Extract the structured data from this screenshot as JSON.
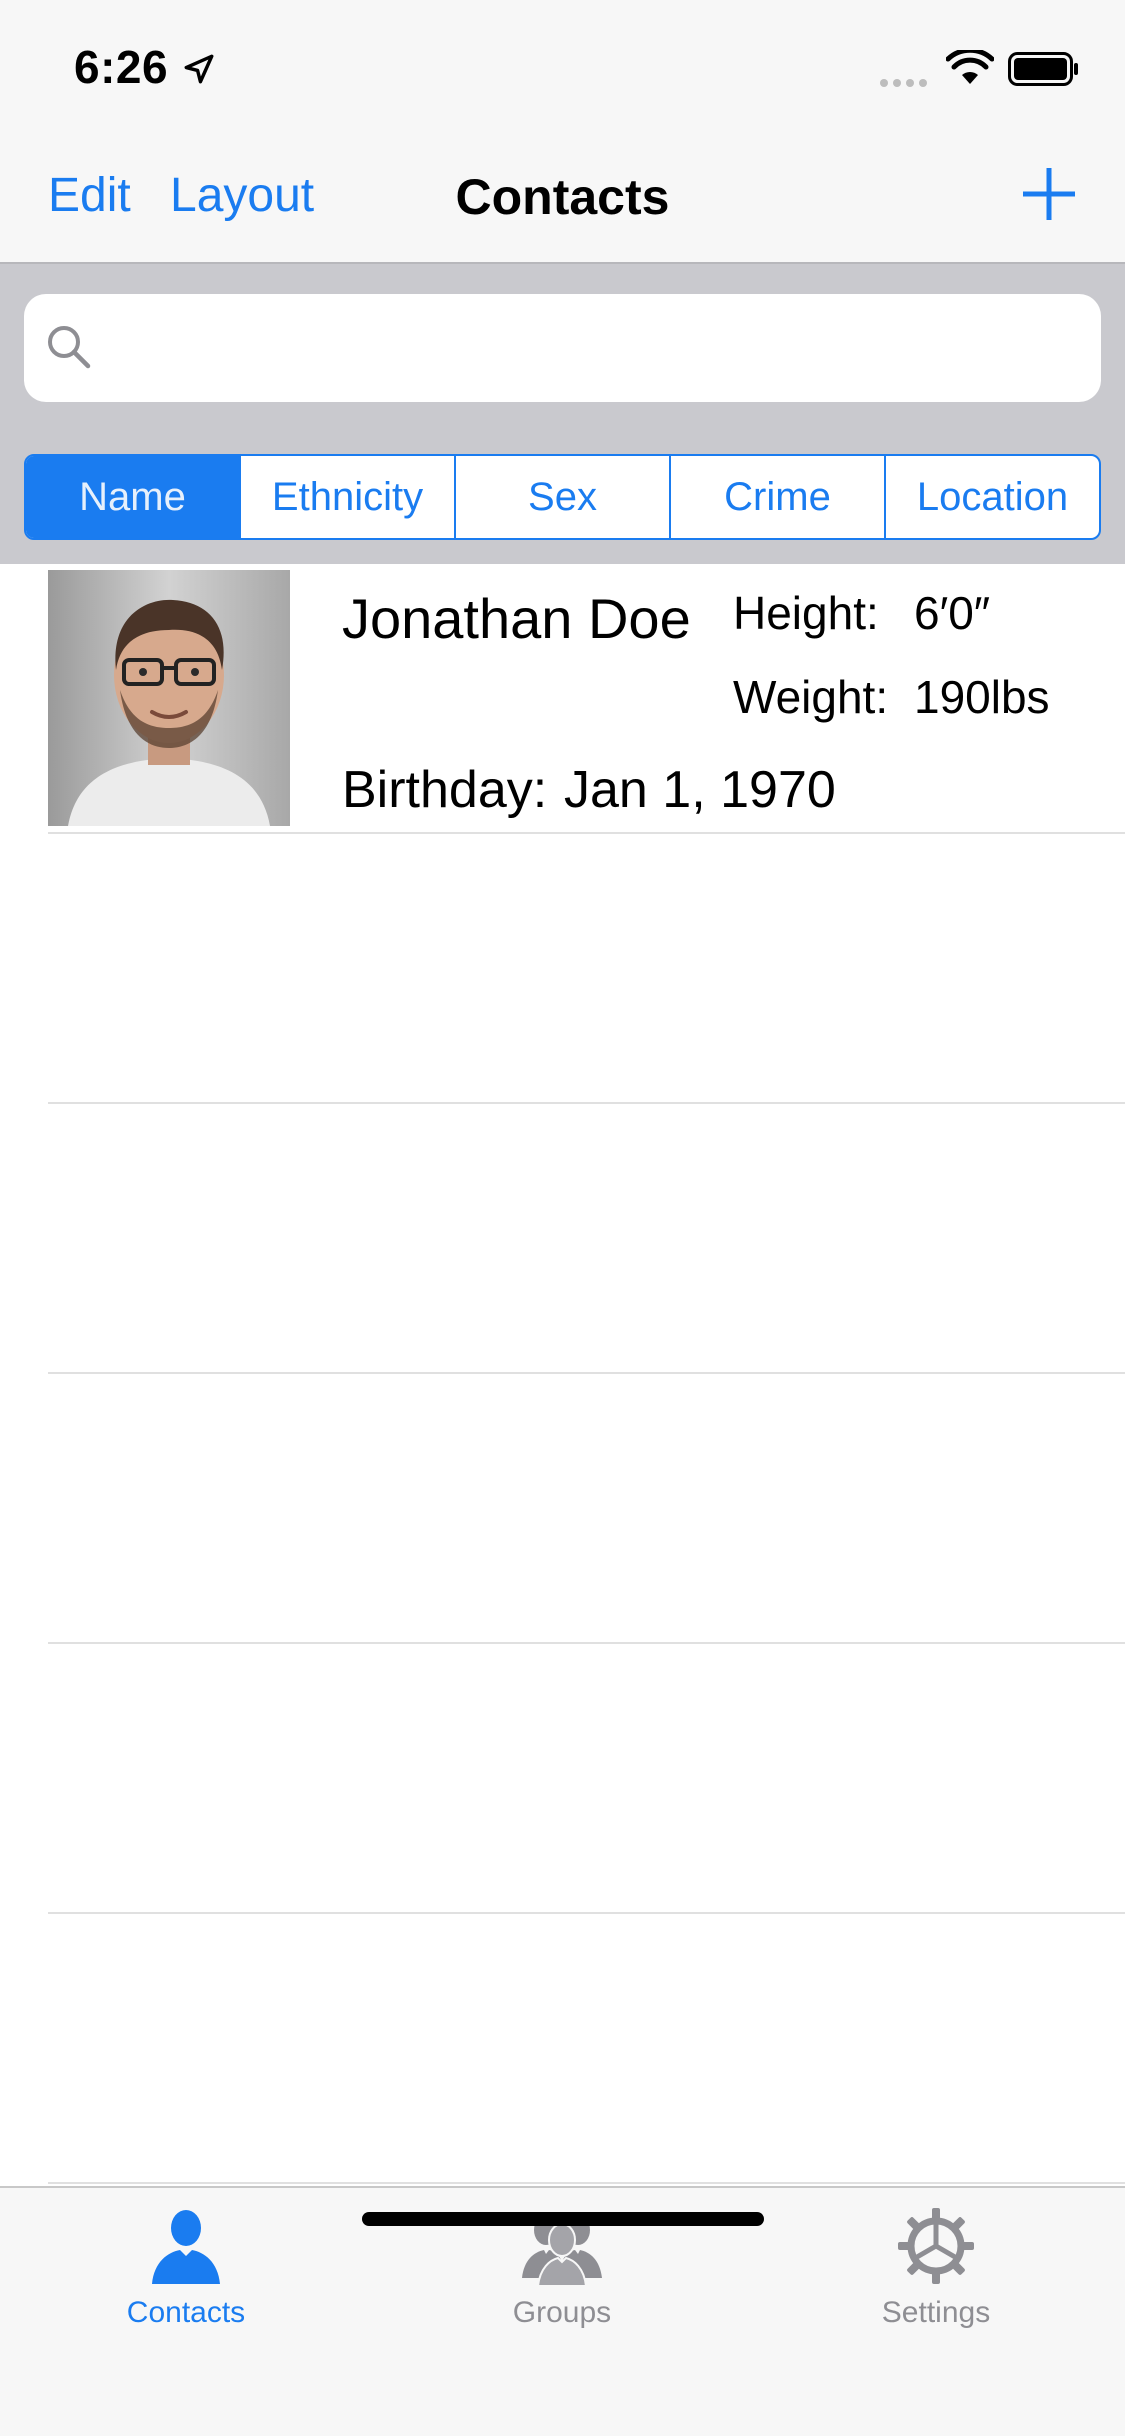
{
  "status_bar": {
    "time": "6:26",
    "icons": [
      "location-arrow-icon",
      "signal-dots-icon",
      "wifi-icon",
      "battery-icon"
    ]
  },
  "nav": {
    "edit_label": "Edit",
    "layout_label": "Layout",
    "title": "Contacts",
    "add_icon": "plus-icon"
  },
  "search": {
    "placeholder": "",
    "icon": "search-icon"
  },
  "segments": {
    "items": [
      "Name",
      "Ethnicity",
      "Sex",
      "Crime",
      "Location"
    ],
    "selected": "Name"
  },
  "contacts": [
    {
      "name": "Jonathan Doe",
      "height_label": "Height:",
      "height": "6′0″",
      "weight_label": "Weight:",
      "weight": "190lbs",
      "birthday_label": "Birthday:",
      "birthday": "Jan 1, 1970"
    }
  ],
  "tabs": [
    {
      "label": "Contacts",
      "icon": "person-icon",
      "active": true
    },
    {
      "label": "Groups",
      "icon": "group-icon",
      "active": false
    },
    {
      "label": "Settings",
      "icon": "gear-icon",
      "active": false
    }
  ],
  "colors": {
    "accent": "#1a7cf0",
    "bar_background": "#f7f7f7",
    "search_region": "#c9c9ce",
    "inactive_tab": "#8e8e93"
  }
}
